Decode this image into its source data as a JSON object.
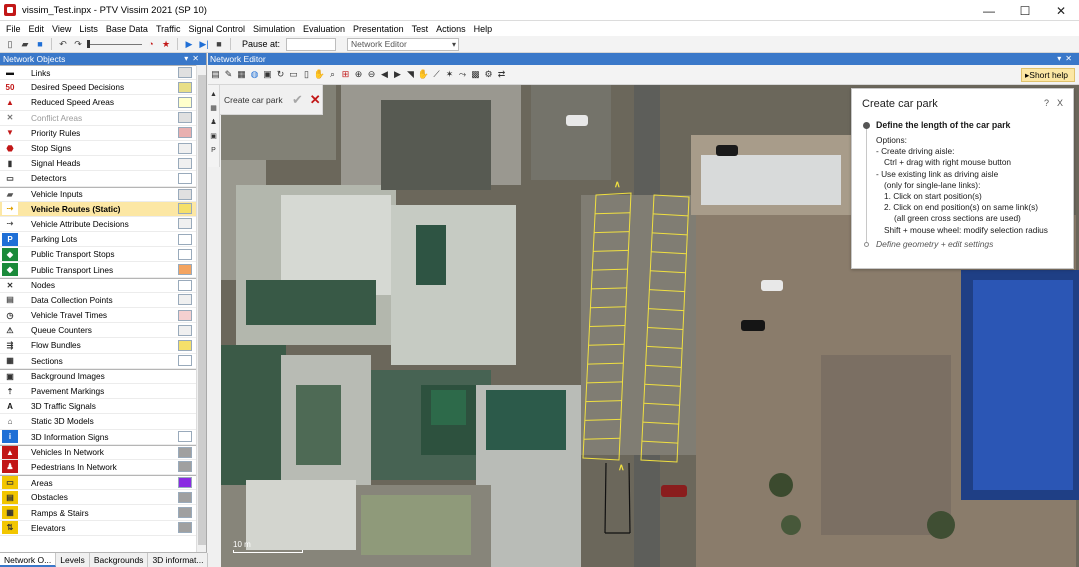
{
  "window": {
    "title": "vissim_Test.inpx - PTV Vissim 2021 (SP 10)",
    "controls": [
      "—",
      "☐",
      "✕"
    ]
  },
  "menu": [
    "File",
    "Edit",
    "View",
    "Lists",
    "Base Data",
    "Traffic",
    "Signal Control",
    "Simulation",
    "Evaluation",
    "Presentation",
    "Test",
    "Actions",
    "Help"
  ],
  "toolbar": {
    "pause_label": "Pause at:",
    "pause_value": "",
    "network_editor_select": "Network Editor"
  },
  "network_objects": {
    "header": "Network Objects",
    "items": [
      {
        "label": "Links",
        "swatch": "#e0e0e0",
        "icon": "link-icon",
        "group_start": true
      },
      {
        "label": "Desired Speed Decisions",
        "swatch": "#e8df88",
        "icon": "speed-sign-icon"
      },
      {
        "label": "Reduced Speed Areas",
        "swatch": "#ffffcc",
        "icon": "warning-sign-icon"
      },
      {
        "label": "Conflict Areas",
        "swatch": "#e0e0e0",
        "icon": "conflict-area-icon",
        "disabled": true
      },
      {
        "label": "Priority Rules",
        "swatch": "#e8b0b0",
        "icon": "priority-rule-icon"
      },
      {
        "label": "Stop Signs",
        "swatch": "#f0f0f0",
        "icon": "stop-sign-icon"
      },
      {
        "label": "Signal Heads",
        "swatch": "#f0f0f0",
        "icon": "signal-head-icon"
      },
      {
        "label": "Detectors",
        "swatch": "#ffffff",
        "icon": "detector-icon"
      },
      {
        "label": "Vehicle Inputs",
        "swatch": "#e0e0e0",
        "icon": "vehicle-input-icon",
        "group_start": true
      },
      {
        "label": "Vehicle Routes (Static)",
        "swatch": "#f5e06a",
        "icon": "vehicle-route-icon",
        "selected": true
      },
      {
        "label": "Vehicle Attribute Decisions",
        "swatch": "#f0f0f0",
        "icon": "attribute-decision-icon"
      },
      {
        "label": "Parking Lots",
        "swatch": "#ffffff",
        "icon": "parking-icon"
      },
      {
        "label": "Public Transport Stops",
        "swatch": "#ffffff",
        "icon": "pt-stop-icon"
      },
      {
        "label": "Public Transport Lines",
        "swatch": "#f4a460",
        "icon": "pt-line-icon"
      },
      {
        "label": "Nodes",
        "swatch": "#ffffff",
        "icon": "node-icon",
        "group_start": true
      },
      {
        "label": "Data Collection Points",
        "swatch": "#f0f0f0",
        "icon": "data-point-icon"
      },
      {
        "label": "Vehicle Travel Times",
        "swatch": "#f4d0d0",
        "icon": "travel-time-icon"
      },
      {
        "label": "Queue Counters",
        "swatch": "#f0f0f0",
        "icon": "queue-counter-icon"
      },
      {
        "label": "Flow Bundles",
        "swatch": "#f5e06a",
        "icon": "flow-bundle-icon"
      },
      {
        "label": "Sections",
        "swatch": "#ffffff",
        "icon": "section-icon"
      },
      {
        "label": "Background Images",
        "swatch": "",
        "icon": "background-image-icon",
        "group_start": true
      },
      {
        "label": "Pavement Markings",
        "swatch": "",
        "icon": "pavement-marking-icon"
      },
      {
        "label": "3D Traffic Signals",
        "swatch": "",
        "icon": "traffic-signal-3d-icon"
      },
      {
        "label": "Static 3D Models",
        "swatch": "",
        "icon": "static-model-icon"
      },
      {
        "label": "3D Information Signs",
        "swatch": "#ffffff",
        "icon": "info-sign-icon"
      },
      {
        "label": "Vehicles In Network",
        "swatch": "#a0a0a0",
        "icon": "vehicles-network-icon",
        "group_start": true
      },
      {
        "label": "Pedestrians In Network",
        "swatch": "#a0a0a0",
        "icon": "pedestrians-network-icon"
      },
      {
        "label": "Areas",
        "swatch": "#8a2be2",
        "icon": "area-icon",
        "group_start": true
      },
      {
        "label": "Obstacles",
        "swatch": "#a0a0a0",
        "icon": "obstacle-icon"
      },
      {
        "label": "Ramps & Stairs",
        "swatch": "#a0a0a0",
        "icon": "ramp-icon"
      },
      {
        "label": "Elevators",
        "swatch": "#a0a0a0",
        "icon": "elevator-icon"
      }
    ],
    "tabs": [
      "Network O...",
      "Levels",
      "Backgrounds",
      "3D informat..."
    ]
  },
  "editor": {
    "header": "Network Editor",
    "short_help": "Short help",
    "carpark_bar_label": "Create car park",
    "scale_label": "10 m"
  },
  "help": {
    "title": "Create car park",
    "help_glyph": "?",
    "close_glyph": "X",
    "step1_title": "Define the length of the car park",
    "lines": [
      "Options:",
      "- Create driving aisle:",
      "Ctrl + drag with right mouse button",
      "- Use existing link as driving aisle",
      "(only for single-lane links):",
      "1. Click on start position(s)",
      "2. Click on end position(s) on same link(s)",
      "(all green cross sections are used)",
      "Shift + mouse wheel: modify selection radius"
    ],
    "step2_title": "Define geometry + edit settings"
  }
}
